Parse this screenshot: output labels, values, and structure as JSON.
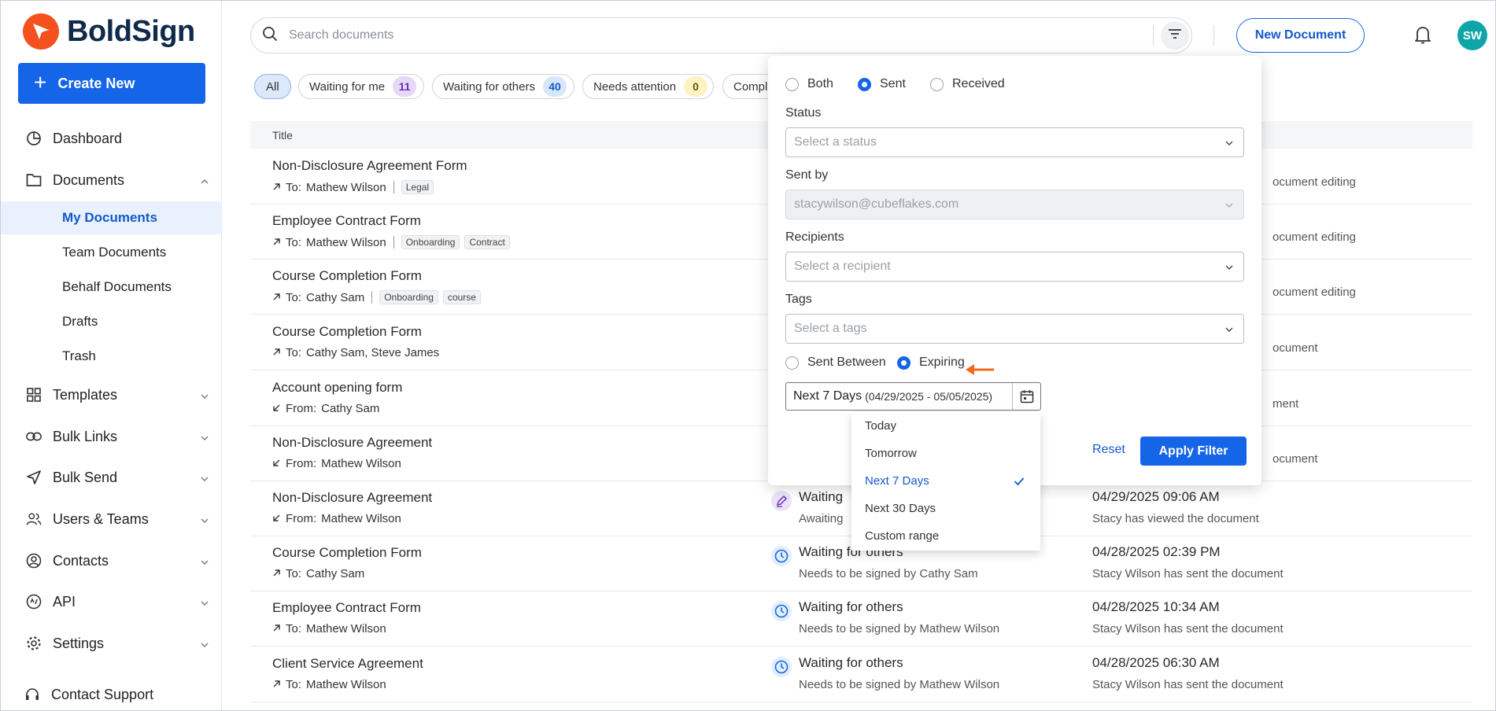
{
  "brand": {
    "name": "BoldSign",
    "logo_color": "#f4511e",
    "accent": "#1565e8"
  },
  "sidebar": {
    "create_label": "Create New",
    "items": [
      {
        "label": "Dashboard",
        "icon": "chart-pie-icon"
      },
      {
        "label": "Documents",
        "icon": "folder-icon"
      },
      {
        "label": "Templates",
        "icon": "grid-icon"
      },
      {
        "label": "Bulk Links",
        "icon": "link-icon"
      },
      {
        "label": "Bulk Send",
        "icon": "send-icon"
      },
      {
        "label": "Users & Teams",
        "icon": "users-icon"
      },
      {
        "label": "Contacts",
        "icon": "contact-icon"
      },
      {
        "label": "API",
        "icon": "api-icon"
      },
      {
        "label": "Settings",
        "icon": "gear-icon"
      },
      {
        "label": "Contact Support",
        "icon": "headset-icon"
      }
    ],
    "documents_sub": [
      "My Documents",
      "Team Documents",
      "Behalf Documents",
      "Drafts",
      "Trash"
    ]
  },
  "topbar": {
    "search_placeholder": "Search documents",
    "new_document_label": "New Document",
    "avatar_initials": "SW"
  },
  "chips": [
    {
      "label": "All",
      "count": null
    },
    {
      "label": "Waiting for me",
      "count": "11",
      "badge_bg": "#e6d9f7",
      "badge_fg": "#6a2fb8"
    },
    {
      "label": "Waiting for others",
      "count": "40",
      "badge_bg": "#d6e6fb",
      "badge_fg": "#1559c9"
    },
    {
      "label": "Needs attention",
      "count": "0",
      "badge_bg": "#fdf2c4",
      "badge_fg": "#6b5600"
    },
    {
      "label": "Compl",
      "count": null
    }
  ],
  "table": {
    "title_header": "Title",
    "rows": [
      {
        "title": "Non-Disclosure Agreement Form",
        "dir": "To:",
        "people": "Mathew Wilson",
        "tags": [
          "Legal"
        ],
        "status": "",
        "status_sub": "",
        "date": "",
        "activity": "ocument editing"
      },
      {
        "title": "Employee Contract Form",
        "dir": "To:",
        "people": "Mathew Wilson",
        "tags": [
          "Onboarding",
          "Contract"
        ],
        "status": "",
        "status_sub": "",
        "date": "",
        "activity": "ocument editing"
      },
      {
        "title": "Course Completion Form",
        "dir": "To:",
        "people": "Cathy Sam",
        "tags": [
          "Onboarding",
          "course"
        ],
        "status": "",
        "status_sub": "",
        "date": "",
        "activity": "ocument editing"
      },
      {
        "title": "Course Completion Form",
        "dir": "To:",
        "people": "Cathy Sam, Steve James",
        "tags": [],
        "status": "",
        "status_sub": "",
        "date": "",
        "activity": "ocument"
      },
      {
        "title": "Account opening form",
        "dir": "From:",
        "people": "Cathy Sam",
        "tags": [],
        "status": "",
        "status_sub": "",
        "date": "",
        "activity": "ment"
      },
      {
        "title": "Non-Disclosure Agreement",
        "dir": "From:",
        "people": "Mathew Wilson",
        "tags": [],
        "status": "",
        "status_sub": "",
        "date": "",
        "activity": "ocument"
      },
      {
        "title": "Non-Disclosure Agreement",
        "dir": "From:",
        "people": "Mathew Wilson",
        "tags": [],
        "status": "Waiting",
        "status_sub": "Awaiting",
        "date": "04/29/2025 09:06 AM",
        "activity": "Stacy has viewed the document",
        "status_icon": "pen-icon"
      },
      {
        "title": "Course Completion Form",
        "dir": "To:",
        "people": "Cathy Sam",
        "tags": [],
        "status": "Waiting for others",
        "status_sub": "Needs to be signed by Cathy Sam",
        "date": "04/28/2025 02:39 PM",
        "activity": "Stacy Wilson has sent the document",
        "status_icon": "clock-icon"
      },
      {
        "title": "Employee Contract Form",
        "dir": "To:",
        "people": "Mathew Wilson",
        "tags": [],
        "status": "Waiting for others",
        "status_sub": "Needs to be signed by Mathew Wilson",
        "date": "04/28/2025 10:34 AM",
        "activity": "Stacy Wilson has sent the document",
        "status_icon": "clock-icon"
      },
      {
        "title": "Client Service Agreement",
        "dir": "To:",
        "people": "Mathew Wilson",
        "tags": [],
        "status": "Waiting for others",
        "status_sub": "Needs to be signed by Mathew Wilson",
        "date": "04/28/2025 06:30 AM",
        "activity": "Stacy Wilson has sent the document",
        "status_icon": "clock-icon"
      }
    ]
  },
  "filter": {
    "direction": {
      "options": [
        "Both",
        "Sent",
        "Received"
      ],
      "selected": "Sent"
    },
    "status": {
      "label": "Status",
      "placeholder": "Select a status"
    },
    "sent_by": {
      "label": "Sent by",
      "value": "stacywilson@cubeflakes.com"
    },
    "recipients": {
      "label": "Recipients",
      "placeholder": "Select a recipient"
    },
    "tags": {
      "label": "Tags",
      "placeholder": "Select a tags"
    },
    "date_mode": {
      "options": [
        "Sent Between",
        "Expiring"
      ],
      "selected": "Expiring"
    },
    "date_range": {
      "preset": "Next 7 Days",
      "range": "(04/29/2025 - 05/05/2025)"
    },
    "reset_label": "Reset",
    "apply_label": "Apply Filter",
    "range_options": [
      "Today",
      "Tomorrow",
      "Next 7 Days",
      "Next 30 Days",
      "Custom range"
    ],
    "range_selected": "Next 7 Days",
    "pointer_color": "#f26b1d"
  }
}
